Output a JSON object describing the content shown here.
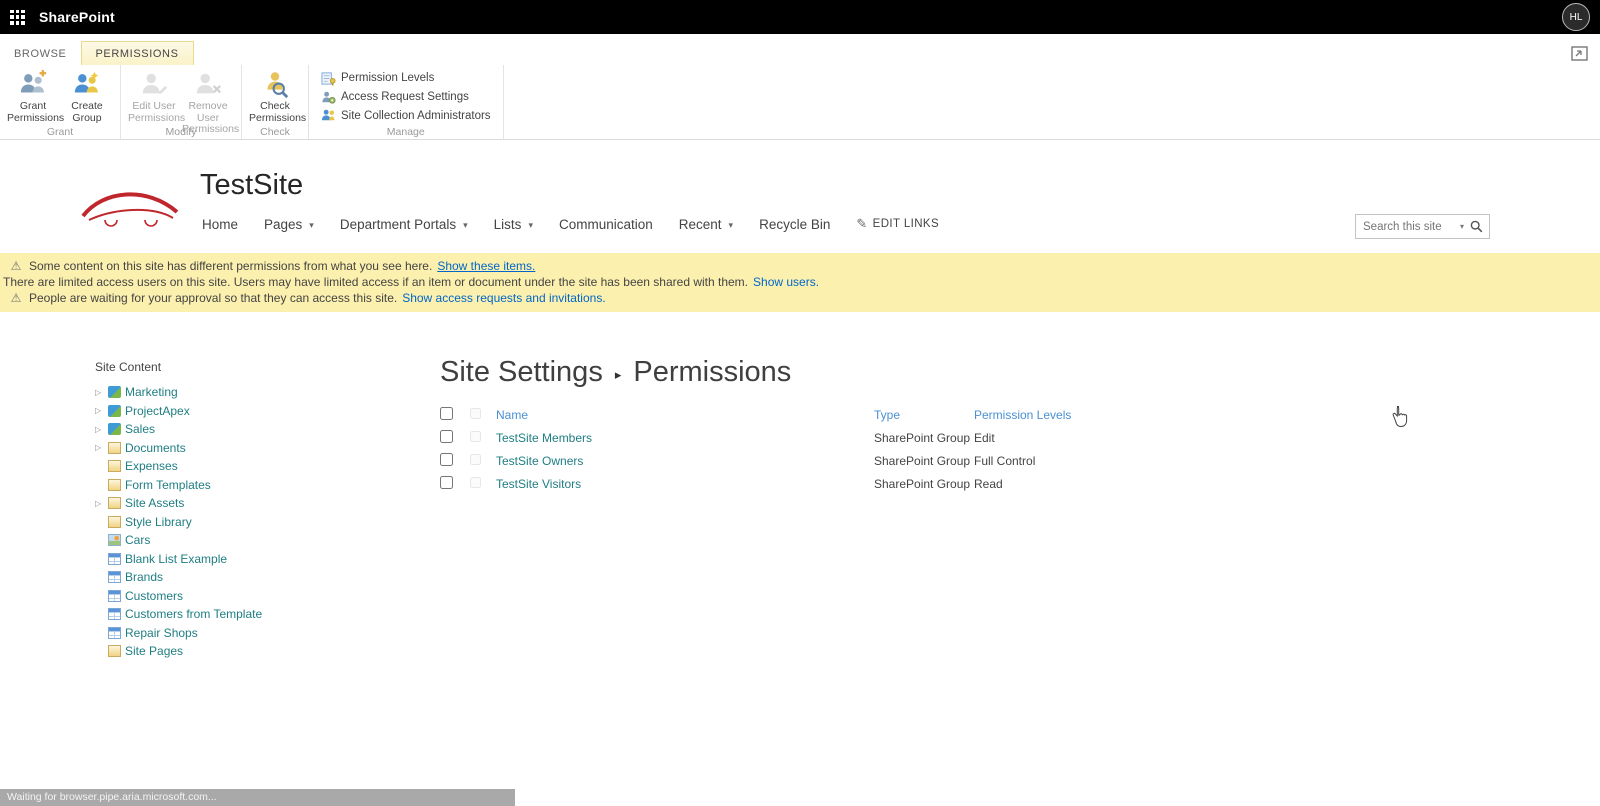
{
  "colors": {
    "accent_blue": "#0072c6",
    "teal_link": "#1f7e83",
    "banner_bg": "#fbf0ae",
    "topbar_bg": "#000000",
    "active_tab_bg": "#faf2c8"
  },
  "topbar": {
    "brand": "SharePoint",
    "avatar_initials": "HL"
  },
  "ribbon": {
    "tabs": [
      {
        "label": "BROWSE"
      },
      {
        "label": "PERMISSIONS"
      }
    ],
    "groups": {
      "grant": {
        "label": "Grant",
        "buttons": [
          {
            "label": "Grant Permissions"
          },
          {
            "label": "Create Group"
          }
        ]
      },
      "modify": {
        "label": "Modify",
        "buttons": [
          {
            "label": "Edit User Permissions"
          },
          {
            "label": "Remove User Permissions"
          }
        ]
      },
      "check": {
        "label": "Check",
        "buttons": [
          {
            "label": "Check Permissions"
          }
        ]
      },
      "manage": {
        "label": "Manage",
        "items": [
          {
            "label": "Permission Levels"
          },
          {
            "label": "Access Request Settings"
          },
          {
            "label": "Site Collection Administrators"
          }
        ]
      }
    }
  },
  "site_header": {
    "title": "TestSite",
    "nav": [
      {
        "label": "Home",
        "dropdown": false
      },
      {
        "label": "Pages",
        "dropdown": true
      },
      {
        "label": "Department Portals",
        "dropdown": true
      },
      {
        "label": "Lists",
        "dropdown": true
      },
      {
        "label": "Communication",
        "dropdown": false
      },
      {
        "label": "Recent",
        "dropdown": true
      },
      {
        "label": "Recycle Bin",
        "dropdown": false
      }
    ],
    "edit_links": "EDIT LINKS",
    "search_placeholder": "Search this site"
  },
  "banner": {
    "lines": [
      {
        "warn_icon": true,
        "text": "Some content on this site has different permissions from what you see here.",
        "link": "Show these items."
      },
      {
        "warn_icon": false,
        "text": "There are limited access users on this site. Users may have limited access if an item or document under the site has been shared with them.",
        "link": "Show users."
      },
      {
        "warn_icon": true,
        "text": "People are waiting for your approval so that they can access this site.",
        "link": "Show access requests and invitations."
      }
    ]
  },
  "sidebar": {
    "title": "Site Content",
    "items": [
      {
        "label": "Marketing",
        "icon": "site",
        "expandable": true
      },
      {
        "label": "ProjectApex",
        "icon": "site",
        "expandable": true
      },
      {
        "label": "Sales",
        "icon": "site",
        "expandable": true
      },
      {
        "label": "Documents",
        "icon": "library",
        "expandable": true
      },
      {
        "label": "Expenses",
        "icon": "library",
        "expandable": false
      },
      {
        "label": "Form Templates",
        "icon": "library",
        "expandable": false
      },
      {
        "label": "Site Assets",
        "icon": "library",
        "expandable": true
      },
      {
        "label": "Style Library",
        "icon": "library",
        "expandable": false
      },
      {
        "label": "Cars",
        "icon": "picture-library",
        "expandable": false
      },
      {
        "label": "Blank List Example",
        "icon": "list",
        "expandable": false
      },
      {
        "label": "Brands",
        "icon": "list",
        "expandable": false
      },
      {
        "label": "Customers",
        "icon": "list",
        "expandable": false
      },
      {
        "label": "Customers from Template",
        "icon": "list",
        "expandable": false
      },
      {
        "label": "Repair Shops",
        "icon": "list",
        "expandable": false
      },
      {
        "label": "Site Pages",
        "icon": "library",
        "expandable": false
      }
    ]
  },
  "main": {
    "breadcrumb": {
      "parent": "Site Settings",
      "separator": "▸",
      "current": "Permissions"
    },
    "table": {
      "headers": {
        "name": "Name",
        "type": "Type",
        "levels": "Permission Levels"
      },
      "rows": [
        {
          "name": "TestSite Members",
          "type": "SharePoint Group",
          "level": "Edit"
        },
        {
          "name": "TestSite Owners",
          "type": "SharePoint Group",
          "level": "Full Control"
        },
        {
          "name": "TestSite Visitors",
          "type": "SharePoint Group",
          "level": "Read"
        }
      ]
    }
  },
  "statusbar": {
    "text": "Waiting for browser.pipe.aria.microsoft.com..."
  }
}
